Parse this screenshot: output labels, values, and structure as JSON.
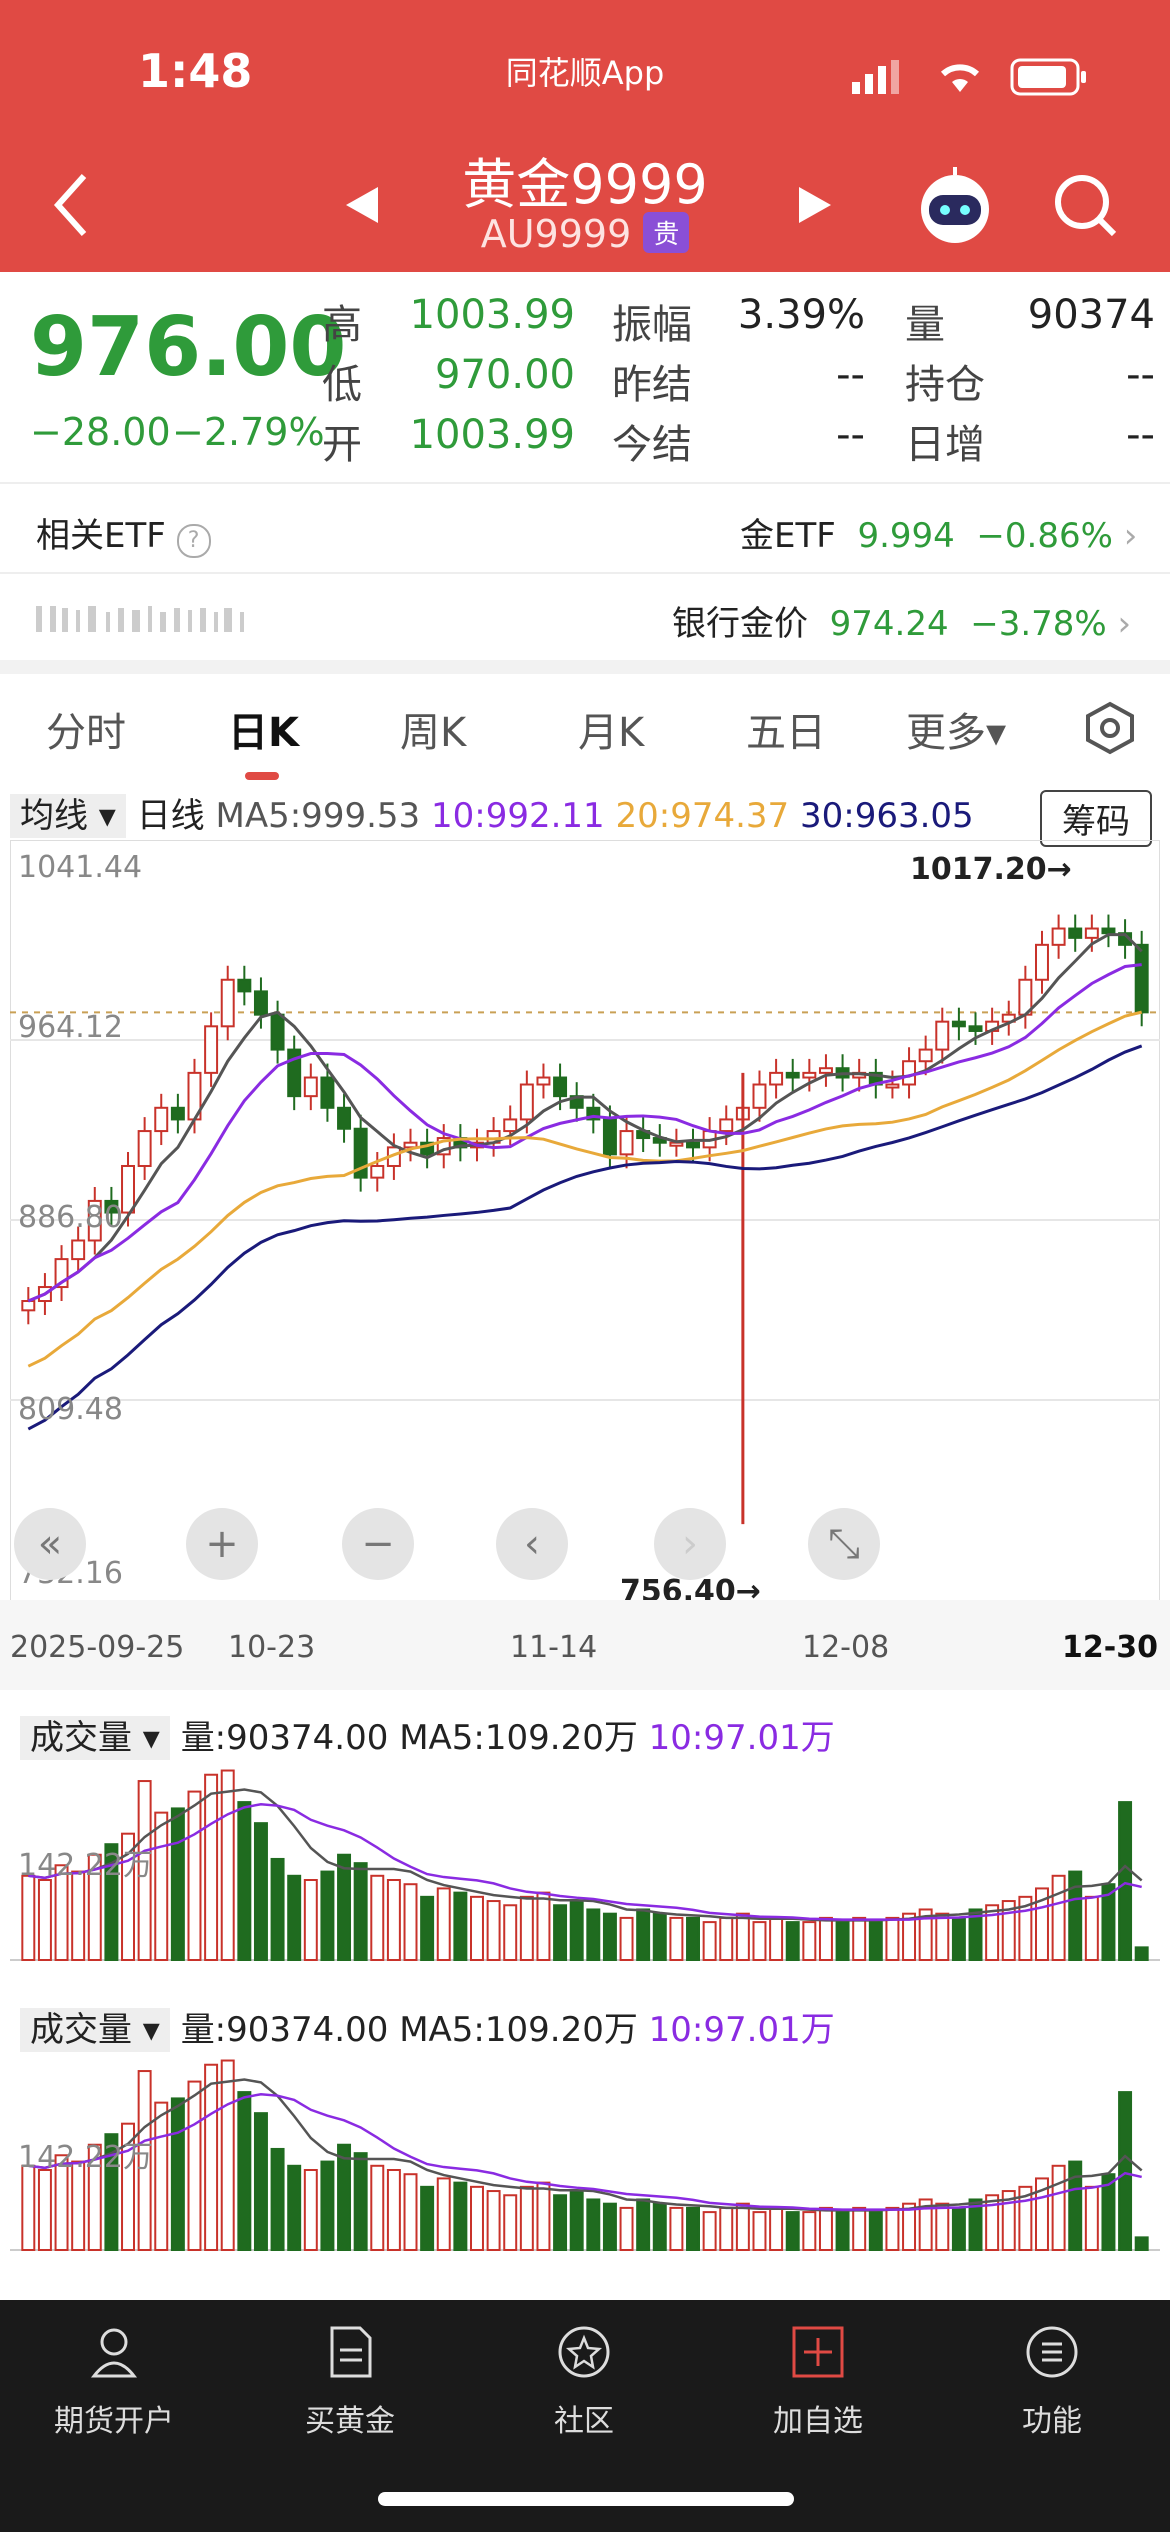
{
  "status": {
    "time": "1:48",
    "app": "同花顺App"
  },
  "header": {
    "title": "黄金9999",
    "code": "AU9999",
    "badge": "贵"
  },
  "quote": {
    "price": "976.00",
    "change": "−28.00",
    "change_pct": "−2.79%",
    "high_label": "高",
    "high": "1003.99",
    "low_label": "低",
    "low": "970.00",
    "open_label": "开",
    "open": "1003.99",
    "amp_label": "振幅",
    "amp": "3.39%",
    "prev_settle_label": "昨结",
    "prev_settle": "--",
    "settle_label": "今结",
    "settle": "--",
    "vol_label": "量",
    "vol": "90374",
    "oi_label": "持仓",
    "oi": "--",
    "daily_inc_label": "日增",
    "daily_inc": "--"
  },
  "etf_row": {
    "label": "相关ETF",
    "name": "金ETF",
    "price": "9.994",
    "pct": "−0.86%"
  },
  "bank_row": {
    "label": "银行金价",
    "price": "974.24",
    "pct": "−3.78%"
  },
  "tabs": [
    "分时",
    "日K",
    "周K",
    "月K",
    "五日",
    "更多▾"
  ],
  "ma_bar": {
    "dropdown": "均线 ▾",
    "period": "日线",
    "ma5": "MA5:999.53",
    "ma10": "10:992.11",
    "ma20": "20:974.37",
    "ma30": "30:963.05",
    "chip": "筹码"
  },
  "colors": {
    "up": "#c8322a",
    "down": "#1f6b1f",
    "ma5": "#555555",
    "ma10": "#8a2be2",
    "ma20": "#e8a93a",
    "ma30": "#1a1a7a",
    "header": "#e04a44"
  },
  "chart_data": {
    "type": "candlestick",
    "y_ticks": [
      "1041.44",
      "964.12",
      "886.80",
      "809.48",
      "732.16"
    ],
    "ylim": [
      732.16,
      1041.44
    ],
    "x_ticks": [
      "2025-09-25",
      "10-23",
      "11-14",
      "12-08",
      "12-30"
    ],
    "max_label": "1017.20→",
    "min_label": "756.40→",
    "close": [
      852,
      858,
      870,
      878,
      895,
      890,
      910,
      925,
      935,
      930,
      950,
      970,
      990,
      985,
      975,
      960,
      940,
      948,
      935,
      926,
      905,
      910,
      918,
      920,
      915,
      922,
      918,
      920,
      925,
      930,
      945,
      948,
      940,
      935,
      930,
      915,
      925,
      922,
      920,
      920,
      918,
      925,
      930,
      935,
      945,
      950,
      948,
      950,
      952,
      948,
      950,
      945,
      945,
      955,
      960,
      972,
      970,
      968,
      972,
      975,
      990,
      1005,
      1012,
      1008,
      1012,
      1010,
      1005,
      976
    ]
  },
  "volume": {
    "head": "成交量 ▾",
    "vol": "量:90374.00",
    "ma5": "MA5:109.20万",
    "ma10": "10:97.01万",
    "tick": "142.22万"
  },
  "controls": [
    "«",
    "+",
    "−",
    "‹",
    "›",
    "⤡"
  ],
  "nav": [
    {
      "label": "期货开户",
      "icon": "person-icon"
    },
    {
      "label": "买黄金",
      "icon": "document-icon"
    },
    {
      "label": "社区",
      "icon": "star-badge-icon"
    },
    {
      "label": "加自选",
      "icon": "add-box-icon"
    },
    {
      "label": "功能",
      "icon": "menu-circle-icon"
    }
  ]
}
